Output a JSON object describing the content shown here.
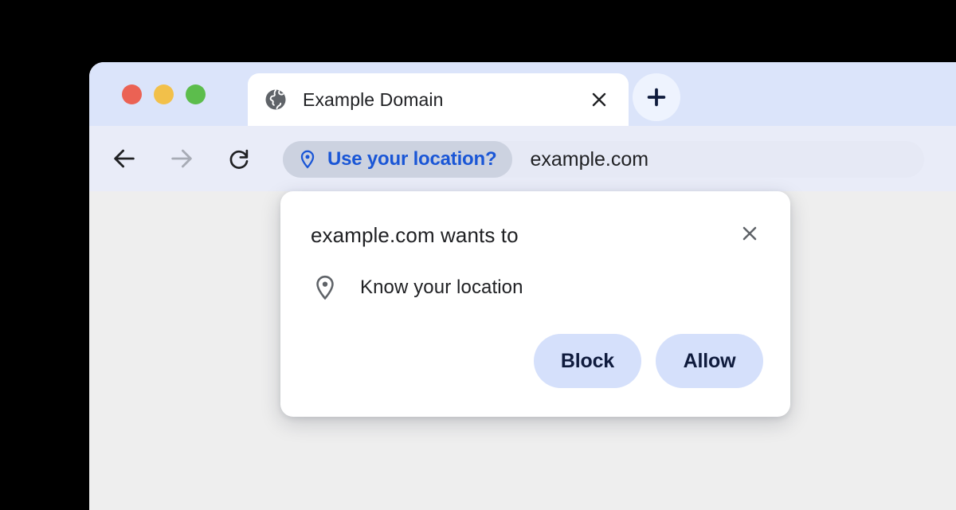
{
  "window": {
    "traffic_lights": [
      {
        "name": "close",
        "color": "#eb6254"
      },
      {
        "name": "minimize",
        "color": "#f2c04a"
      },
      {
        "name": "maximize",
        "color": "#5cbd4c"
      }
    ]
  },
  "tab_strip": {
    "tab": {
      "favicon": "globe-icon",
      "title": "Example Domain",
      "close_icon": "close-icon"
    },
    "new_tab": {
      "icon": "plus-icon",
      "label": "+"
    }
  },
  "toolbar": {
    "back": {
      "icon": "arrow-left-icon",
      "enabled": true
    },
    "forward": {
      "icon": "arrow-right-icon",
      "enabled": false
    },
    "reload": {
      "icon": "reload-icon",
      "enabled": true
    },
    "omnibox": {
      "permission_chip": {
        "icon": "location-pin-icon",
        "label": "Use your location?",
        "color": "#1a56d6"
      },
      "url": "example.com"
    }
  },
  "permission_dialog": {
    "title": "example.com wants to",
    "close_icon": "close-icon",
    "permission": {
      "icon": "location-pin-icon",
      "label": "Know your location"
    },
    "buttons": [
      {
        "name": "block",
        "label": "Block"
      },
      {
        "name": "allow",
        "label": "Allow"
      }
    ]
  },
  "colors": {
    "tab_strip_bg": "#dbe4fa",
    "toolbar_bg": "#e9ecf8",
    "page_bg": "#eeeeee",
    "accent_blue": "#1a56d6",
    "button_bg": "#d5e0fb",
    "button_text": "#0f1b3d"
  }
}
